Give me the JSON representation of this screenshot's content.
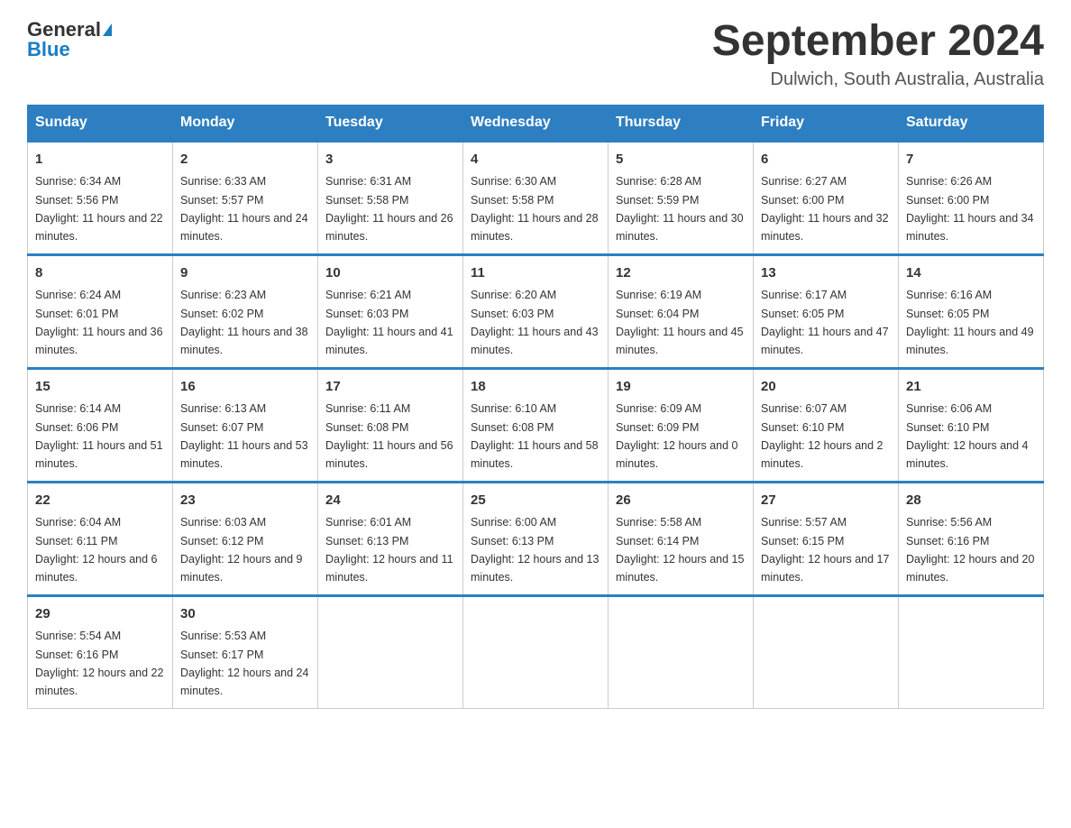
{
  "header": {
    "logo_general": "General",
    "logo_blue": "Blue",
    "month_title": "September 2024",
    "location": "Dulwich, South Australia, Australia"
  },
  "days_of_week": [
    "Sunday",
    "Monday",
    "Tuesday",
    "Wednesday",
    "Thursday",
    "Friday",
    "Saturday"
  ],
  "weeks": [
    [
      {
        "day": "1",
        "sunrise": "6:34 AM",
        "sunset": "5:56 PM",
        "daylight": "11 hours and 22 minutes."
      },
      {
        "day": "2",
        "sunrise": "6:33 AM",
        "sunset": "5:57 PM",
        "daylight": "11 hours and 24 minutes."
      },
      {
        "day": "3",
        "sunrise": "6:31 AM",
        "sunset": "5:58 PM",
        "daylight": "11 hours and 26 minutes."
      },
      {
        "day": "4",
        "sunrise": "6:30 AM",
        "sunset": "5:58 PM",
        "daylight": "11 hours and 28 minutes."
      },
      {
        "day": "5",
        "sunrise": "6:28 AM",
        "sunset": "5:59 PM",
        "daylight": "11 hours and 30 minutes."
      },
      {
        "day": "6",
        "sunrise": "6:27 AM",
        "sunset": "6:00 PM",
        "daylight": "11 hours and 32 minutes."
      },
      {
        "day": "7",
        "sunrise": "6:26 AM",
        "sunset": "6:00 PM",
        "daylight": "11 hours and 34 minutes."
      }
    ],
    [
      {
        "day": "8",
        "sunrise": "6:24 AM",
        "sunset": "6:01 PM",
        "daylight": "11 hours and 36 minutes."
      },
      {
        "day": "9",
        "sunrise": "6:23 AM",
        "sunset": "6:02 PM",
        "daylight": "11 hours and 38 minutes."
      },
      {
        "day": "10",
        "sunrise": "6:21 AM",
        "sunset": "6:03 PM",
        "daylight": "11 hours and 41 minutes."
      },
      {
        "day": "11",
        "sunrise": "6:20 AM",
        "sunset": "6:03 PM",
        "daylight": "11 hours and 43 minutes."
      },
      {
        "day": "12",
        "sunrise": "6:19 AM",
        "sunset": "6:04 PM",
        "daylight": "11 hours and 45 minutes."
      },
      {
        "day": "13",
        "sunrise": "6:17 AM",
        "sunset": "6:05 PM",
        "daylight": "11 hours and 47 minutes."
      },
      {
        "day": "14",
        "sunrise": "6:16 AM",
        "sunset": "6:05 PM",
        "daylight": "11 hours and 49 minutes."
      }
    ],
    [
      {
        "day": "15",
        "sunrise": "6:14 AM",
        "sunset": "6:06 PM",
        "daylight": "11 hours and 51 minutes."
      },
      {
        "day": "16",
        "sunrise": "6:13 AM",
        "sunset": "6:07 PM",
        "daylight": "11 hours and 53 minutes."
      },
      {
        "day": "17",
        "sunrise": "6:11 AM",
        "sunset": "6:08 PM",
        "daylight": "11 hours and 56 minutes."
      },
      {
        "day": "18",
        "sunrise": "6:10 AM",
        "sunset": "6:08 PM",
        "daylight": "11 hours and 58 minutes."
      },
      {
        "day": "19",
        "sunrise": "6:09 AM",
        "sunset": "6:09 PM",
        "daylight": "12 hours and 0 minutes."
      },
      {
        "day": "20",
        "sunrise": "6:07 AM",
        "sunset": "6:10 PM",
        "daylight": "12 hours and 2 minutes."
      },
      {
        "day": "21",
        "sunrise": "6:06 AM",
        "sunset": "6:10 PM",
        "daylight": "12 hours and 4 minutes."
      }
    ],
    [
      {
        "day": "22",
        "sunrise": "6:04 AM",
        "sunset": "6:11 PM",
        "daylight": "12 hours and 6 minutes."
      },
      {
        "day": "23",
        "sunrise": "6:03 AM",
        "sunset": "6:12 PM",
        "daylight": "12 hours and 9 minutes."
      },
      {
        "day": "24",
        "sunrise": "6:01 AM",
        "sunset": "6:13 PM",
        "daylight": "12 hours and 11 minutes."
      },
      {
        "day": "25",
        "sunrise": "6:00 AM",
        "sunset": "6:13 PM",
        "daylight": "12 hours and 13 minutes."
      },
      {
        "day": "26",
        "sunrise": "5:58 AM",
        "sunset": "6:14 PM",
        "daylight": "12 hours and 15 minutes."
      },
      {
        "day": "27",
        "sunrise": "5:57 AM",
        "sunset": "6:15 PM",
        "daylight": "12 hours and 17 minutes."
      },
      {
        "day": "28",
        "sunrise": "5:56 AM",
        "sunset": "6:16 PM",
        "daylight": "12 hours and 20 minutes."
      }
    ],
    [
      {
        "day": "29",
        "sunrise": "5:54 AM",
        "sunset": "6:16 PM",
        "daylight": "12 hours and 22 minutes."
      },
      {
        "day": "30",
        "sunrise": "5:53 AM",
        "sunset": "6:17 PM",
        "daylight": "12 hours and 24 minutes."
      },
      {
        "day": "",
        "sunrise": "",
        "sunset": "",
        "daylight": ""
      },
      {
        "day": "",
        "sunrise": "",
        "sunset": "",
        "daylight": ""
      },
      {
        "day": "",
        "sunrise": "",
        "sunset": "",
        "daylight": ""
      },
      {
        "day": "",
        "sunrise": "",
        "sunset": "",
        "daylight": ""
      },
      {
        "day": "",
        "sunrise": "",
        "sunset": "",
        "daylight": ""
      }
    ]
  ]
}
